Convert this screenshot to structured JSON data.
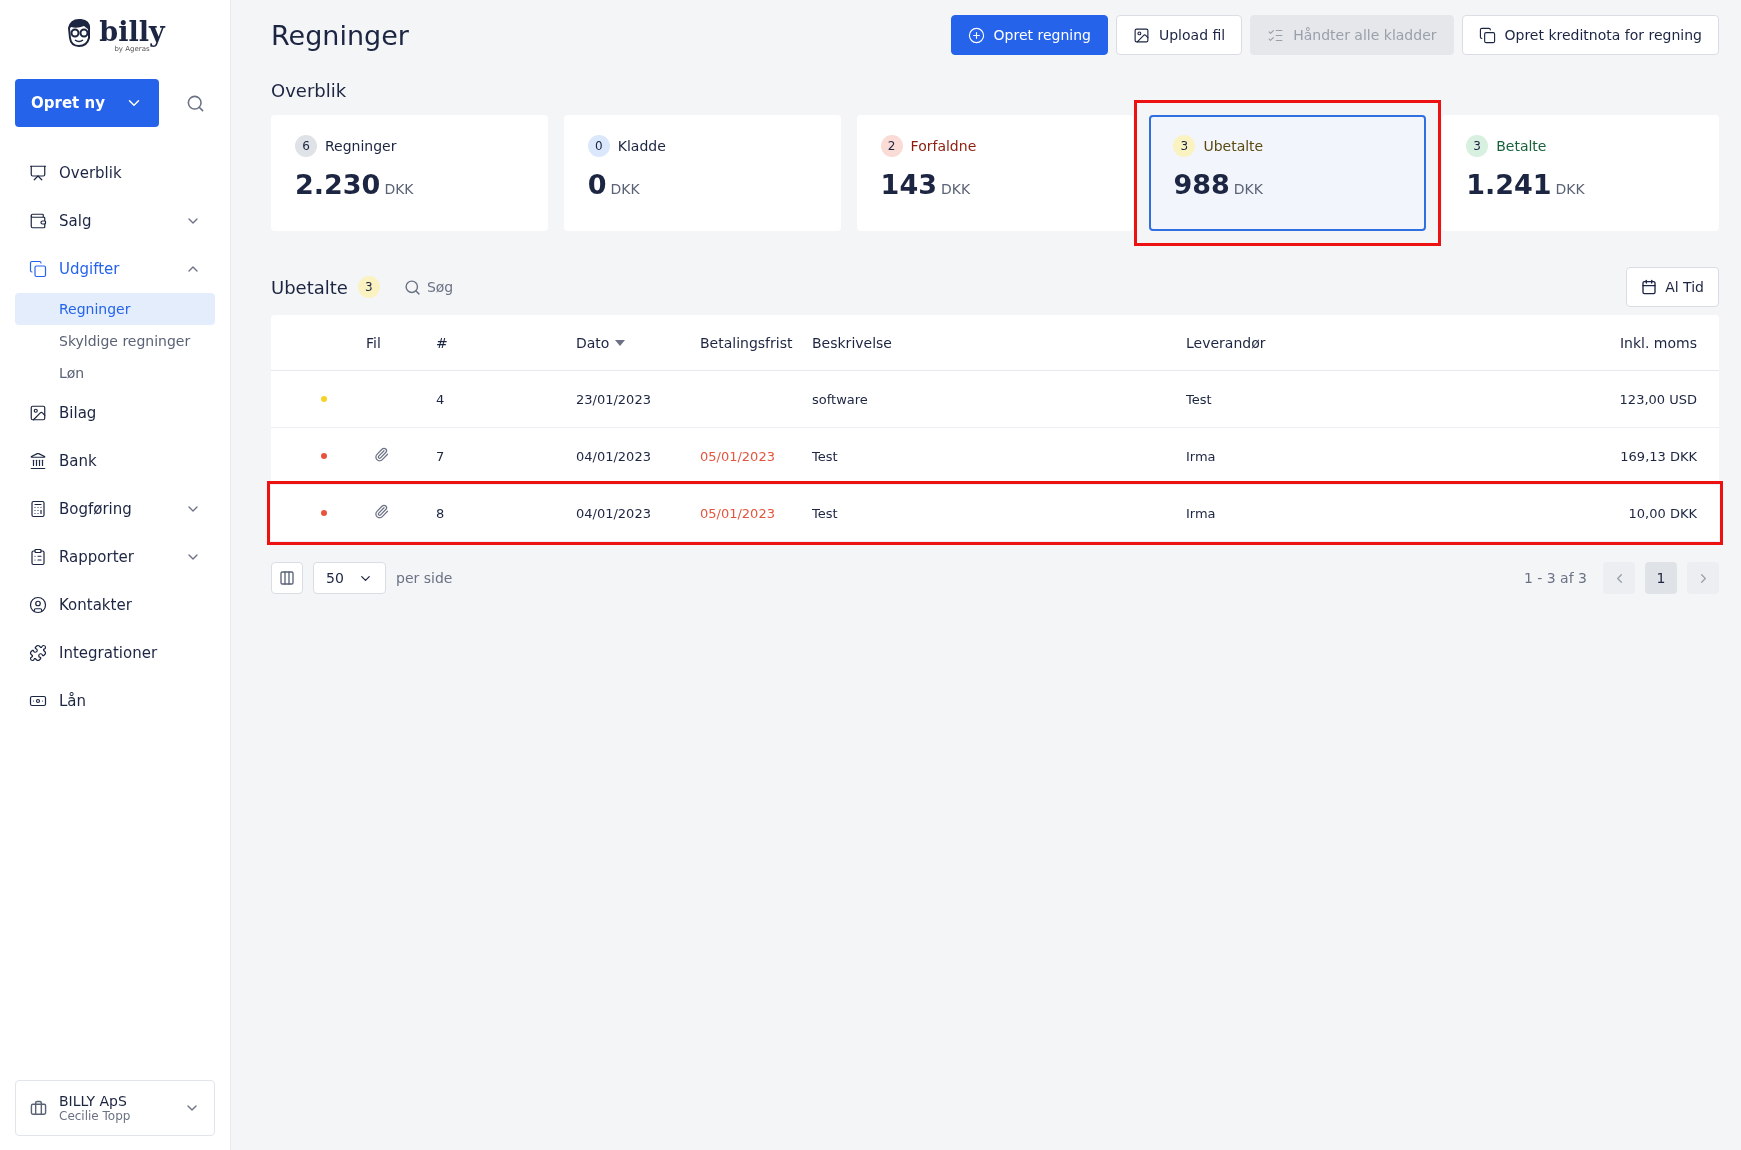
{
  "sidebar": {
    "logo": {
      "name": "billy",
      "tagline": "by Ageras"
    },
    "create_button": "Opret ny",
    "items": [
      {
        "label": "Overblik",
        "selected": false
      },
      {
        "label": "Salg",
        "selected": false,
        "expanded": false
      },
      {
        "label": "Udgifter",
        "selected": true,
        "expanded": true,
        "children": [
          {
            "label": "Regninger",
            "selected": true
          },
          {
            "label": "Skyldige regninger",
            "selected": false
          },
          {
            "label": "Løn",
            "selected": false
          }
        ]
      },
      {
        "label": "Bilag",
        "selected": false
      },
      {
        "label": "Bank",
        "selected": false
      },
      {
        "label": "Bogføring",
        "selected": false,
        "expanded": false
      },
      {
        "label": "Rapporter",
        "selected": false,
        "expanded": false
      },
      {
        "label": "Kontakter",
        "selected": false
      },
      {
        "label": "Integrationer",
        "selected": false
      },
      {
        "label": "Lån",
        "selected": false
      }
    ],
    "organization": {
      "name": "BILLY ApS",
      "user": "Cecilie Topp"
    }
  },
  "page": {
    "title": "Regninger",
    "actions": [
      {
        "label": "Opret regning",
        "kind": "primary"
      },
      {
        "label": "Upload fil",
        "kind": "secondary"
      },
      {
        "label": "Håndter alle kladder",
        "kind": "disabled"
      },
      {
        "label": "Opret kreditnota for regning",
        "kind": "secondary"
      }
    ]
  },
  "overview": {
    "title": "Overblik",
    "cards": [
      {
        "count": "6",
        "label": "Regninger",
        "amount": "2.230",
        "currency": "DKK",
        "color": "#dfe2e7",
        "selected": false,
        "highlighted": false
      },
      {
        "count": "0",
        "label": "Kladde",
        "amount": "0",
        "currency": "DKK",
        "color": "#dbe8fb",
        "selected": false,
        "highlighted": false
      },
      {
        "count": "2",
        "label": "Forfaldne",
        "amount": "143",
        "currency": "DKK",
        "color": "#fadbd6",
        "selected": false,
        "highlighted": false
      },
      {
        "count": "3",
        "label": "Ubetalte",
        "amount": "988",
        "currency": "DKK",
        "color": "#fbf2c2",
        "selected": true,
        "highlighted": true
      },
      {
        "count": "3",
        "label": "Betalte",
        "amount": "1.241",
        "currency": "DKK",
        "color": "#d7f0df",
        "selected": false,
        "highlighted": false
      }
    ]
  },
  "list": {
    "title": "Ubetalte",
    "count": "3",
    "search_placeholder": "Søg",
    "period_button": "Al Tid",
    "columns": [
      {
        "label": "Fil",
        "sorted": false
      },
      {
        "label": "#",
        "sorted": false
      },
      {
        "label": "Dato",
        "sorted": true
      },
      {
        "label": "Betalingsfrist",
        "sorted": false
      },
      {
        "label": "Beskrivelse",
        "sorted": false
      },
      {
        "label": "Leverandør",
        "sorted": false
      },
      {
        "label": "Inkl. moms",
        "sorted": false
      }
    ],
    "rows": [
      {
        "color": "#f5d327",
        "attachment": false,
        "number": "4",
        "date": "23/01/2023",
        "description": "software",
        "supplier": "Test",
        "total": "123,00 USD",
        "highlighted": false
      },
      {
        "color": "#e8533c",
        "attachment": true,
        "number": "7",
        "date": "04/01/2023",
        "due": "05/01/2023",
        "overdue": true,
        "description": "Test",
        "supplier": "Irma",
        "total": "169,13 DKK",
        "highlighted": false
      },
      {
        "color": "#e8533c",
        "attachment": true,
        "number": "8",
        "date": "04/01/2023",
        "due": "05/01/2023",
        "overdue": true,
        "description": "Test",
        "supplier": "Irma",
        "total": "10,00 DKK",
        "highlighted": true
      }
    ]
  },
  "pagination": {
    "page_size": "50",
    "per_page_label": "per side",
    "range": "1 - 3 af 3",
    "pages": [
      {
        "label": "1",
        "selected": true
      }
    ]
  }
}
